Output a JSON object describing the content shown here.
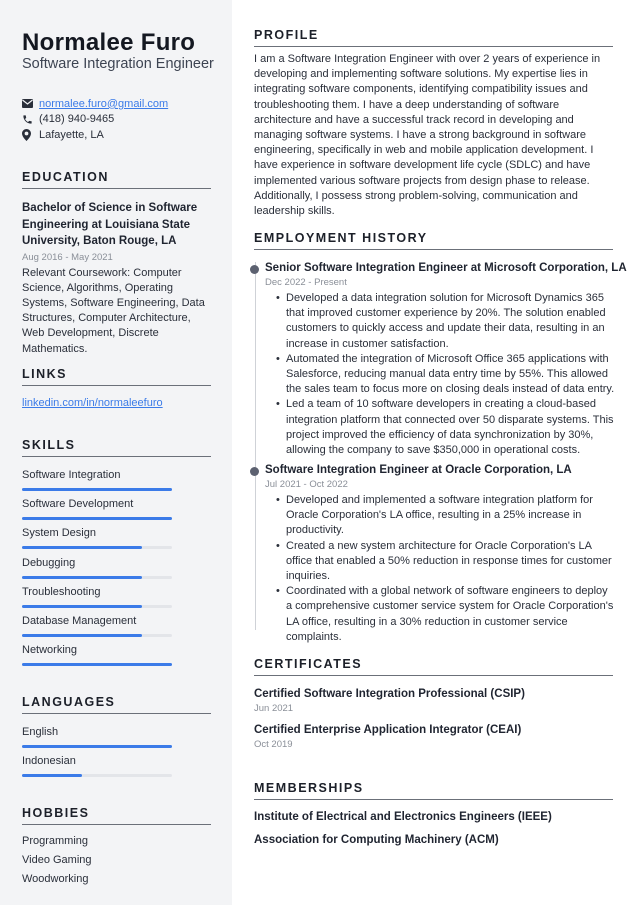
{
  "header": {
    "name": "Normalee Furo",
    "role": "Software Integration Engineer"
  },
  "contact": {
    "email": "normalee.furo@gmail.com",
    "phone": "(418) 940-9465",
    "location": "Lafayette, LA",
    "icons": [
      "envelope-icon",
      "phone-icon",
      "location-pin-icon"
    ]
  },
  "education": {
    "heading": "EDUCATION",
    "degree": "Bachelor of Science in Software Engineering at Louisiana State University, Baton Rouge, LA",
    "dates": "Aug 2016 - May 2021",
    "description": "Relevant Coursework: Computer Science, Algorithms, Operating Systems, Software Engineering, Data Structures, Computer Architecture, Web Development, Discrete Mathematics."
  },
  "links": {
    "heading": "LINKS",
    "items": [
      "linkedin.com/in/normaleefuro"
    ]
  },
  "skills": {
    "heading": "SKILLS",
    "accent": "#3b7be8",
    "items": [
      {
        "label": "Software Integration",
        "level": 100
      },
      {
        "label": "Software Development",
        "level": 100
      },
      {
        "label": "System Design",
        "level": 80
      },
      {
        "label": "Debugging",
        "level": 80
      },
      {
        "label": "Troubleshooting",
        "level": 80
      },
      {
        "label": "Database Management",
        "level": 80
      },
      {
        "label": "Networking",
        "level": 100
      }
    ]
  },
  "languages": {
    "heading": "LANGUAGES",
    "items": [
      {
        "label": "English",
        "level": 100
      },
      {
        "label": "Indonesian",
        "level": 40
      }
    ]
  },
  "hobbies": {
    "heading": "HOBBIES",
    "items": [
      "Programming",
      "Video Gaming",
      "Woodworking"
    ]
  },
  "profile": {
    "heading": "PROFILE",
    "text": "I am a Software Integration Engineer with over 2 years of experience in developing and implementing software solutions. My expertise lies in integrating software components, identifying compatibility issues and troubleshooting them. I have a deep understanding of software architecture and have a successful track record in developing and managing software systems. I have a strong background in software engineering, specifically in web and mobile application development. I have experience in software development life cycle (SDLC) and have implemented various software projects from design phase to release. Additionally, I possess strong problem-solving, communication and leadership skills."
  },
  "employment": {
    "heading": "EMPLOYMENT HISTORY",
    "jobs": [
      {
        "title": "Senior Software Integration Engineer at Microsoft Corporation, LA",
        "dates": "Dec 2022 - Present",
        "bullets": [
          "Developed a data integration solution for Microsoft Dynamics 365 that improved customer experience by 20%. The solution enabled customers to quickly access and update their data, resulting in an increase in customer satisfaction.",
          "Automated the integration of Microsoft Office 365 applications with Salesforce, reducing manual data entry time by 55%. This allowed the sales team to focus more on closing deals instead of data entry.",
          "Led a team of 10 software developers in creating a cloud-based integration platform that connected over 50 disparate systems. This project improved the efficiency of data synchronization by 30%, allowing the company to save $350,000 in operational costs."
        ]
      },
      {
        "title": "Software Integration Engineer at Oracle Corporation, LA",
        "dates": "Jul 2021 - Oct 2022",
        "bullets": [
          "Developed and implemented a software integration platform for Oracle Corporation's LA office, resulting in a 25% increase in productivity.",
          "Created a new system architecture for Oracle Corporation's LA office that enabled a 50% reduction in response times for customer inquiries.",
          "Coordinated with a global network of software engineers to deploy a comprehensive customer service system for Oracle Corporation's LA office, resulting in a 30% reduction in customer service complaints."
        ]
      }
    ]
  },
  "certificates": {
    "heading": "CERTIFICATES",
    "items": [
      {
        "title": "Certified Software Integration Professional (CSIP)",
        "date": "Jun 2021"
      },
      {
        "title": "Certified Enterprise Application Integrator (CEAI)",
        "date": "Oct 2019"
      }
    ]
  },
  "memberships": {
    "heading": "MEMBERSHIPS",
    "items": [
      "Institute of Electrical and Electronics Engineers (IEEE)",
      "Association for Computing Machinery (ACM)"
    ]
  }
}
